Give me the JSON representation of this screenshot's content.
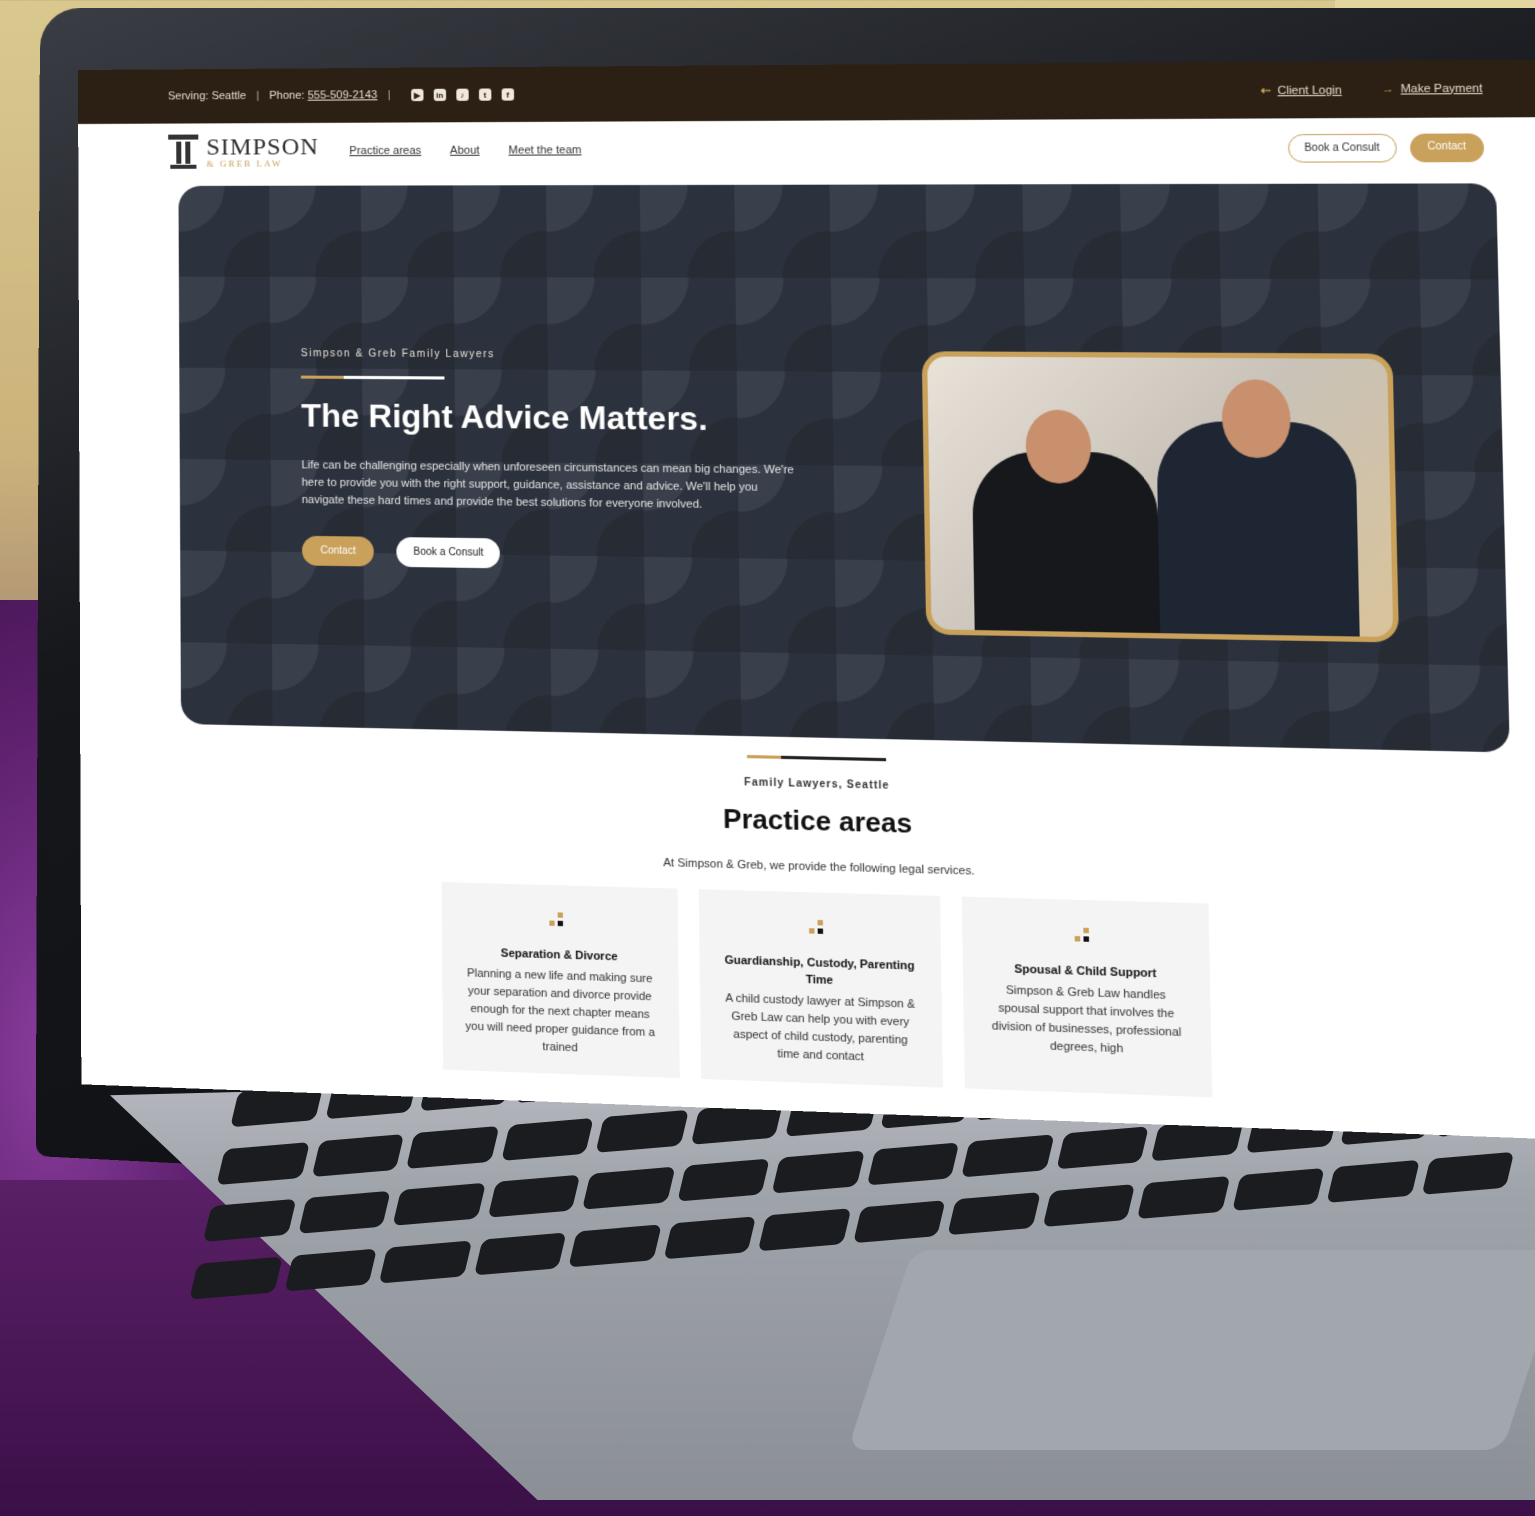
{
  "topbar": {
    "serving": "Serving: Seattle",
    "phone_label": "Phone:",
    "phone": "555-509-2143",
    "socials": [
      "youtube-icon",
      "linkedin-icon",
      "tiktok-icon",
      "twitter-icon",
      "facebook-icon"
    ],
    "client_login": "Client Login",
    "make_payment": "Make Payment"
  },
  "nav": {
    "logo_main": "SIMPSON",
    "logo_sub": "& GREB LAW",
    "links": [
      "Practice areas",
      "About",
      "Meet the team"
    ],
    "book_label": "Book a Consult",
    "contact_label": "Contact"
  },
  "hero": {
    "eyebrow": "Simpson & Greb Family Lawyers",
    "title": "The Right Advice Matters.",
    "text": "Life can be challenging especially when unforeseen circumstances can mean big changes. We're here to provide you with the right support, guidance, assistance and advice. We'll help you navigate these hard times and provide the best solutions for everyone involved.",
    "contact_label": "Contact",
    "book_label": "Book a Consult"
  },
  "practice": {
    "eyebrow": "Family Lawyers, Seattle",
    "title": "Practice areas",
    "intro": "At Simpson & Greb, we provide the following legal services.",
    "cards": [
      {
        "title": "Separation & Divorce",
        "text": "Planning a new life and making sure your separation and divorce provide enough for the next chapter means you will need proper guidance from a trained"
      },
      {
        "title": "Guardianship, Custody, Parenting Time",
        "text": "A child custody lawyer at Simpson & Greb Law can help you with every aspect of child custody, parenting time and contact"
      },
      {
        "title": "Spousal & Child Support",
        "text": "Simpson & Greb Law handles spousal support that involves the division of businesses, professional degrees, high"
      }
    ]
  },
  "colors": {
    "gold": "#c9a15a",
    "topbar": "#2b2013",
    "hero_bg": "#2c323d"
  }
}
